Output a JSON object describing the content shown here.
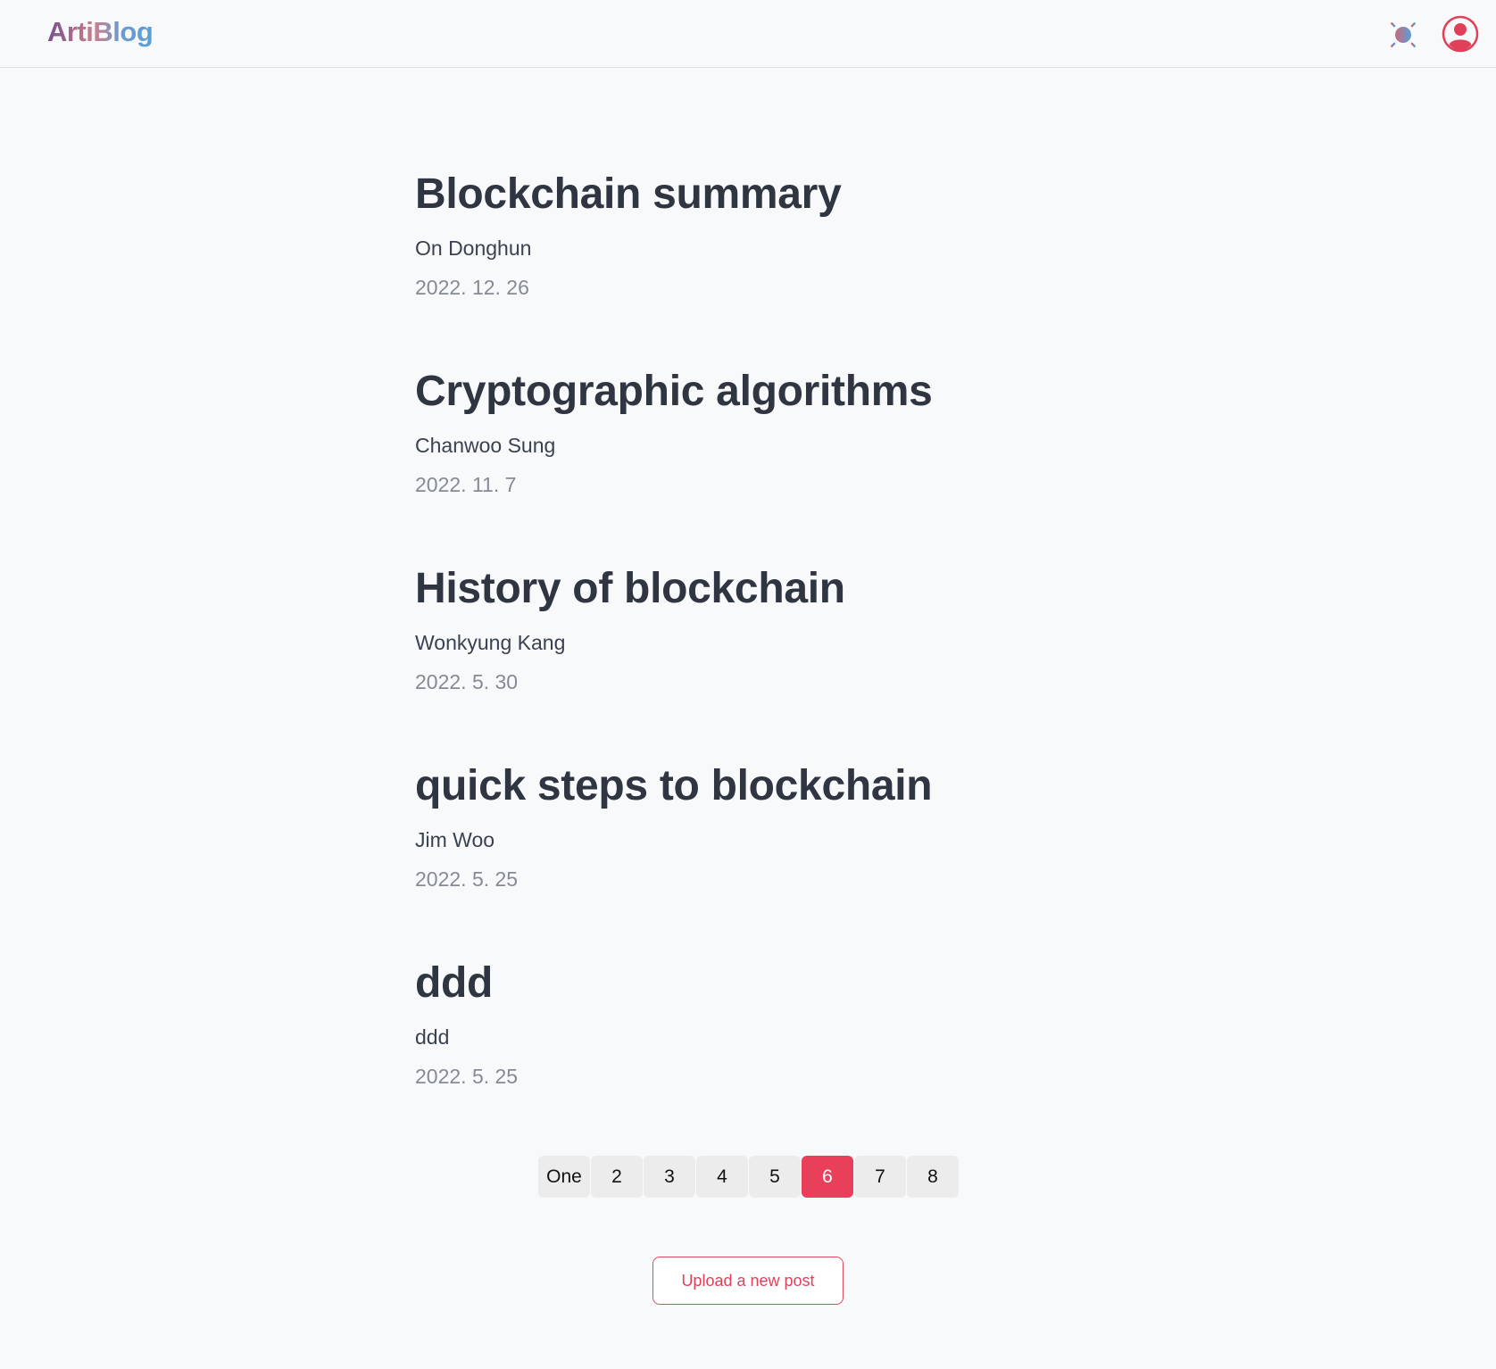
{
  "header": {
    "logo": "ArtiBlog",
    "theme_icon": "sun-icon",
    "profile_icon": "user-circle-icon"
  },
  "posts": [
    {
      "title": "Blockchain summary",
      "author": "On Donghun",
      "date": "2022. 12. 26"
    },
    {
      "title": "Cryptographic algorithms",
      "author": "Chanwoo Sung",
      "date": "2022. 11. 7"
    },
    {
      "title": "History of blockchain",
      "author": "Wonkyung Kang",
      "date": "2022. 5. 30"
    },
    {
      "title": "quick steps to blockchain",
      "author": "Jim Woo",
      "date": "2022. 5. 25"
    },
    {
      "title": "ddd",
      "author": "ddd",
      "date": "2022. 5. 25"
    }
  ],
  "pagination": {
    "pages": [
      "One",
      "2",
      "3",
      "4",
      "5",
      "6",
      "7",
      "8"
    ],
    "current": "6"
  },
  "upload_button": "Upload a new post",
  "colors": {
    "accent": "#e8405a",
    "title": "#2f3541",
    "date": "#858b94",
    "background": "#f8f9fa"
  }
}
